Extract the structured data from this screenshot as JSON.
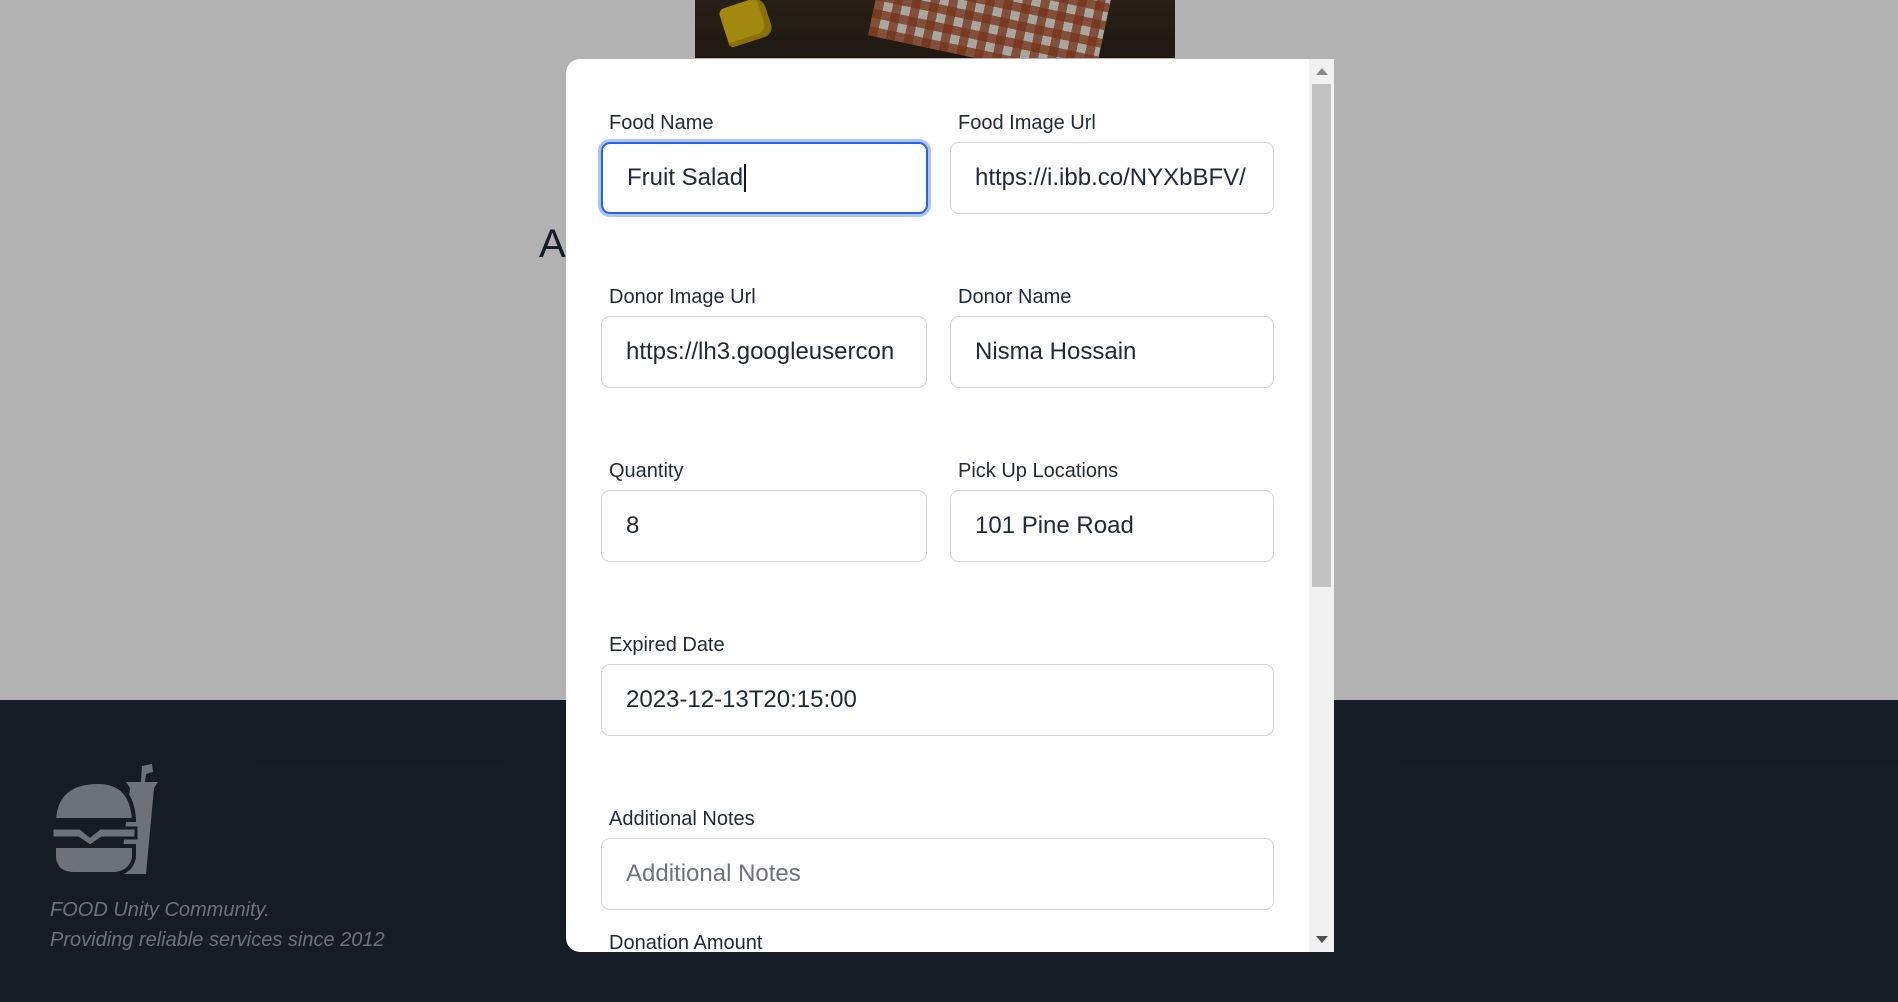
{
  "page": {
    "heading_fragment": "A",
    "footer": {
      "line1": "FOOD Unity Community.",
      "line2": "Providing reliable services since 2012"
    }
  },
  "modal": {
    "fields": {
      "food_name": {
        "label": "Food Name",
        "value": "Fruit Salad"
      },
      "food_image_url": {
        "label": "Food Image Url",
        "value": "https://i.ibb.co/NYXbBFV/"
      },
      "donor_image_url": {
        "label": "Donor Image Url",
        "value": "https://lh3.googleusercon"
      },
      "donor_name": {
        "label": "Donor Name",
        "value": "Nisma Hossain"
      },
      "quantity": {
        "label": "Quantity",
        "value": "8"
      },
      "pickup_location": {
        "label": "Pick Up Locations",
        "value": "101 Pine Road"
      },
      "expired_date": {
        "label": "Expired Date",
        "value": "2023-12-13T20:15:00"
      },
      "additional_notes": {
        "label": "Additional Notes",
        "placeholder": "Additional Notes"
      },
      "donation_amount": {
        "label": "Donation Amount"
      }
    }
  },
  "colors": {
    "footer_bg": "#1f2937",
    "focus_ring": "#2563eb",
    "label_text": "#1f2937"
  },
  "icons": {
    "footer_logo": "burger-drink-icon",
    "scroll_up": "triangle-up-icon",
    "scroll_down": "triangle-down-icon"
  }
}
